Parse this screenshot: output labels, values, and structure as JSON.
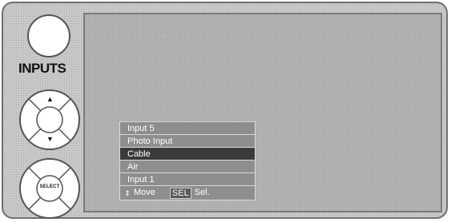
{
  "remote": {
    "inputs_label": "INPUTS",
    "select_label": "SELECT",
    "arrow_up": "▲",
    "arrow_down": "▼"
  },
  "menu": {
    "items": [
      {
        "label": "Input 5",
        "selected": false
      },
      {
        "label": "Photo Input",
        "selected": false
      },
      {
        "label": "Cable",
        "selected": true
      },
      {
        "label": "Air",
        "selected": false
      },
      {
        "label": "Input 1",
        "selected": false
      }
    ],
    "footer": {
      "move_icon": "⇕",
      "move_label": "Move",
      "sel_key": "SEL",
      "sel_label": "Sel."
    }
  },
  "colors": {
    "selected_bg": "#3a3a3a",
    "item_bg": "#8e8e8e"
  }
}
